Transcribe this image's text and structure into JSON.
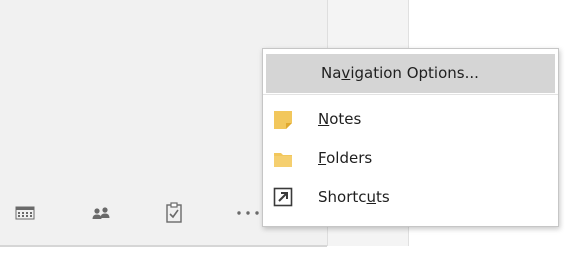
{
  "popup_menu": {
    "items": [
      {
        "label": "Navigation Options...",
        "underline_char": "v",
        "icon": null
      },
      {
        "label": "Notes",
        "underline_char": "N",
        "icon": "notes-icon"
      },
      {
        "label": "Folders",
        "underline_char": "F",
        "icon": "folders-icon"
      },
      {
        "label": "Shortcuts",
        "underline_char": "u",
        "icon": "shortcuts-icon"
      }
    ]
  },
  "nav_bar": {
    "buttons": [
      {
        "name": "calendar-icon"
      },
      {
        "name": "people-icon"
      },
      {
        "name": "tasks-icon"
      },
      {
        "name": "more-icon"
      }
    ]
  },
  "colors": {
    "pane_bg": "#f1f1f1",
    "highlight": "#d5d5d5",
    "folder_yellow": "#f2c75c",
    "icon_gray": "#5c5c5c"
  }
}
